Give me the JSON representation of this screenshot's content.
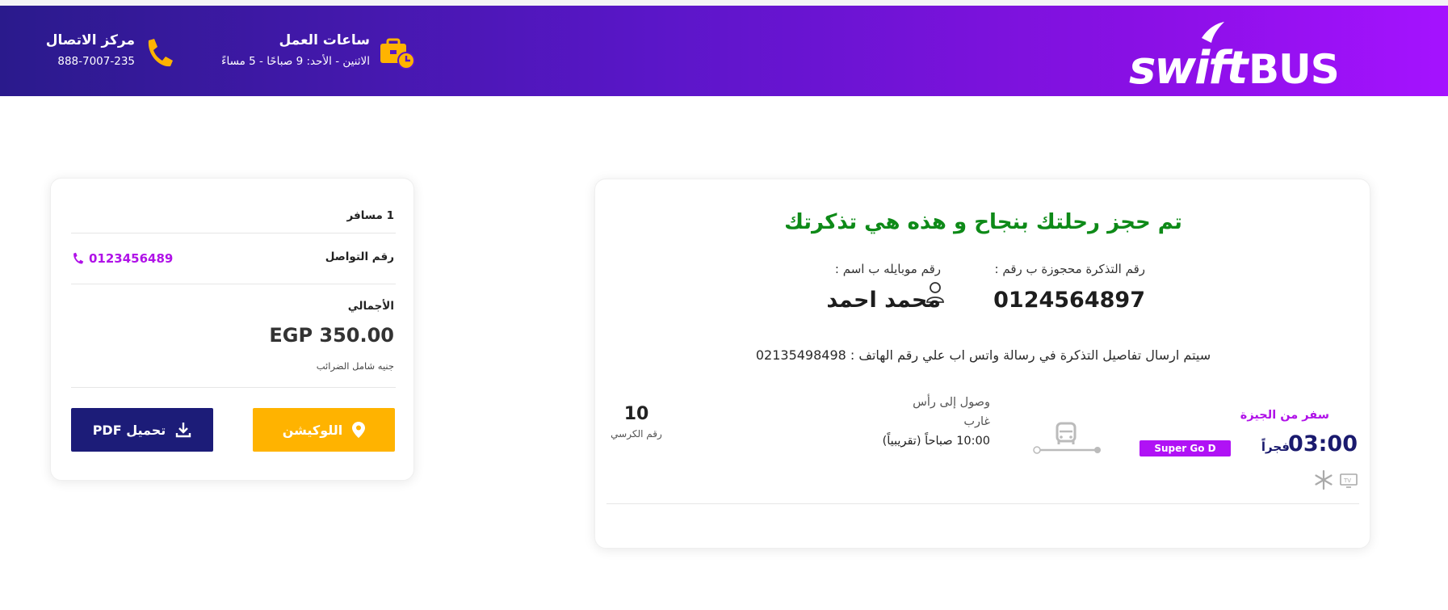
{
  "header": {
    "brand": "swiftBUS",
    "work_hours": {
      "title": "ساعات العمل",
      "subtitle": "الاثنين - الأحد: 9 صباحًا - 5 مساءً"
    },
    "call_center": {
      "title": "مركز الاتصال",
      "phone": "888-7007-235"
    }
  },
  "ticket": {
    "success_title": "تم حجز رحلتك بنجاح و هذه هي تذكرتك",
    "ticket_number_label": "رقم التذكرة محجوزة ب رقم :",
    "ticket_number": "0124564897",
    "name_label": "رقم موبايله ب اسم :",
    "passenger_name": "محمد احمد",
    "whatsapp_note": "سيتم ارسال تفاصيل التذكرة في رسالة واتس اب علي رقم الهاتف : 02135498498",
    "trip": {
      "from_label": "سفر من الجيزة",
      "departure_time": "03:00",
      "departure_period": "فجراً",
      "bus_class": "Super Go D",
      "arrival_line1": "وصول إلى رأس",
      "arrival_line2": "غارب",
      "arrival_time": "10:00 صباحاً (تقريبياً)",
      "seat_number": "10",
      "seat_label": "رقم الكرسي"
    },
    "amenities": [
      "tv-icon",
      "snowflake-icon"
    ]
  },
  "summary": {
    "passengers": "1 مسافر",
    "contact_label": "رقم التواصل",
    "contact_phone": "0123456489",
    "total_label": "الأجمالي",
    "total_value": "EGP 350.00",
    "tax_note": "جنيه شامل الضرائب",
    "location_button": "اللوكيشن",
    "pdf_button": "تحميل PDF"
  },
  "colors": {
    "header_gradient_start": "#2a1a8c",
    "header_gradient_end": "#a512ff",
    "accent_orange": "#ffb300",
    "accent_purple": "#b012e8",
    "success_green": "#0e8a18",
    "navy": "#1c1c78"
  }
}
